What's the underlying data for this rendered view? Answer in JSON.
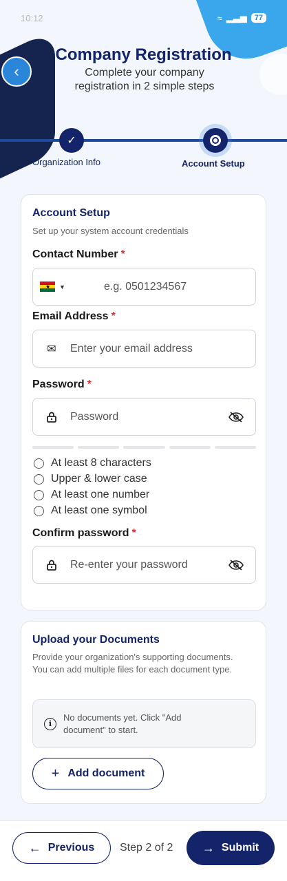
{
  "status_bar": {
    "time": "10:12",
    "battery": "77"
  },
  "header": {
    "title": "Company Registration",
    "subtitle": "Complete your company registration in 2 simple steps"
  },
  "steps": [
    {
      "label": "Organization Info",
      "state": "completed"
    },
    {
      "label": "Account Setup",
      "state": "active"
    }
  ],
  "account": {
    "title": "Account Setup",
    "description": "Set up your system account credentials",
    "contact_label": "Contact Number",
    "contact_placeholder": "e.g. 0501234567",
    "email_label": "Email Address",
    "email_placeholder": "Enter your email address",
    "password_label": "Password",
    "password_placeholder": "Password",
    "requirements": [
      "At least 8 characters",
      "Upper & lower case",
      "At least one number",
      "At least one symbol"
    ],
    "confirm_label": "Confirm password",
    "confirm_placeholder": "Re-enter your password",
    "required_mark": "*"
  },
  "documents": {
    "title": "Upload your Documents",
    "description": "Provide your organization's supporting documents. You can add multiple files for each document type.",
    "empty_message": "No documents yet. Click \"Add document\" to start.",
    "add_label": "Add document"
  },
  "footer": {
    "previous_label": "Previous",
    "step_text": "Step 2 of 2",
    "submit_label": "Submit"
  },
  "colors": {
    "primary": "#14246a",
    "accent": "#2a86d9",
    "required": "#d8353b"
  }
}
